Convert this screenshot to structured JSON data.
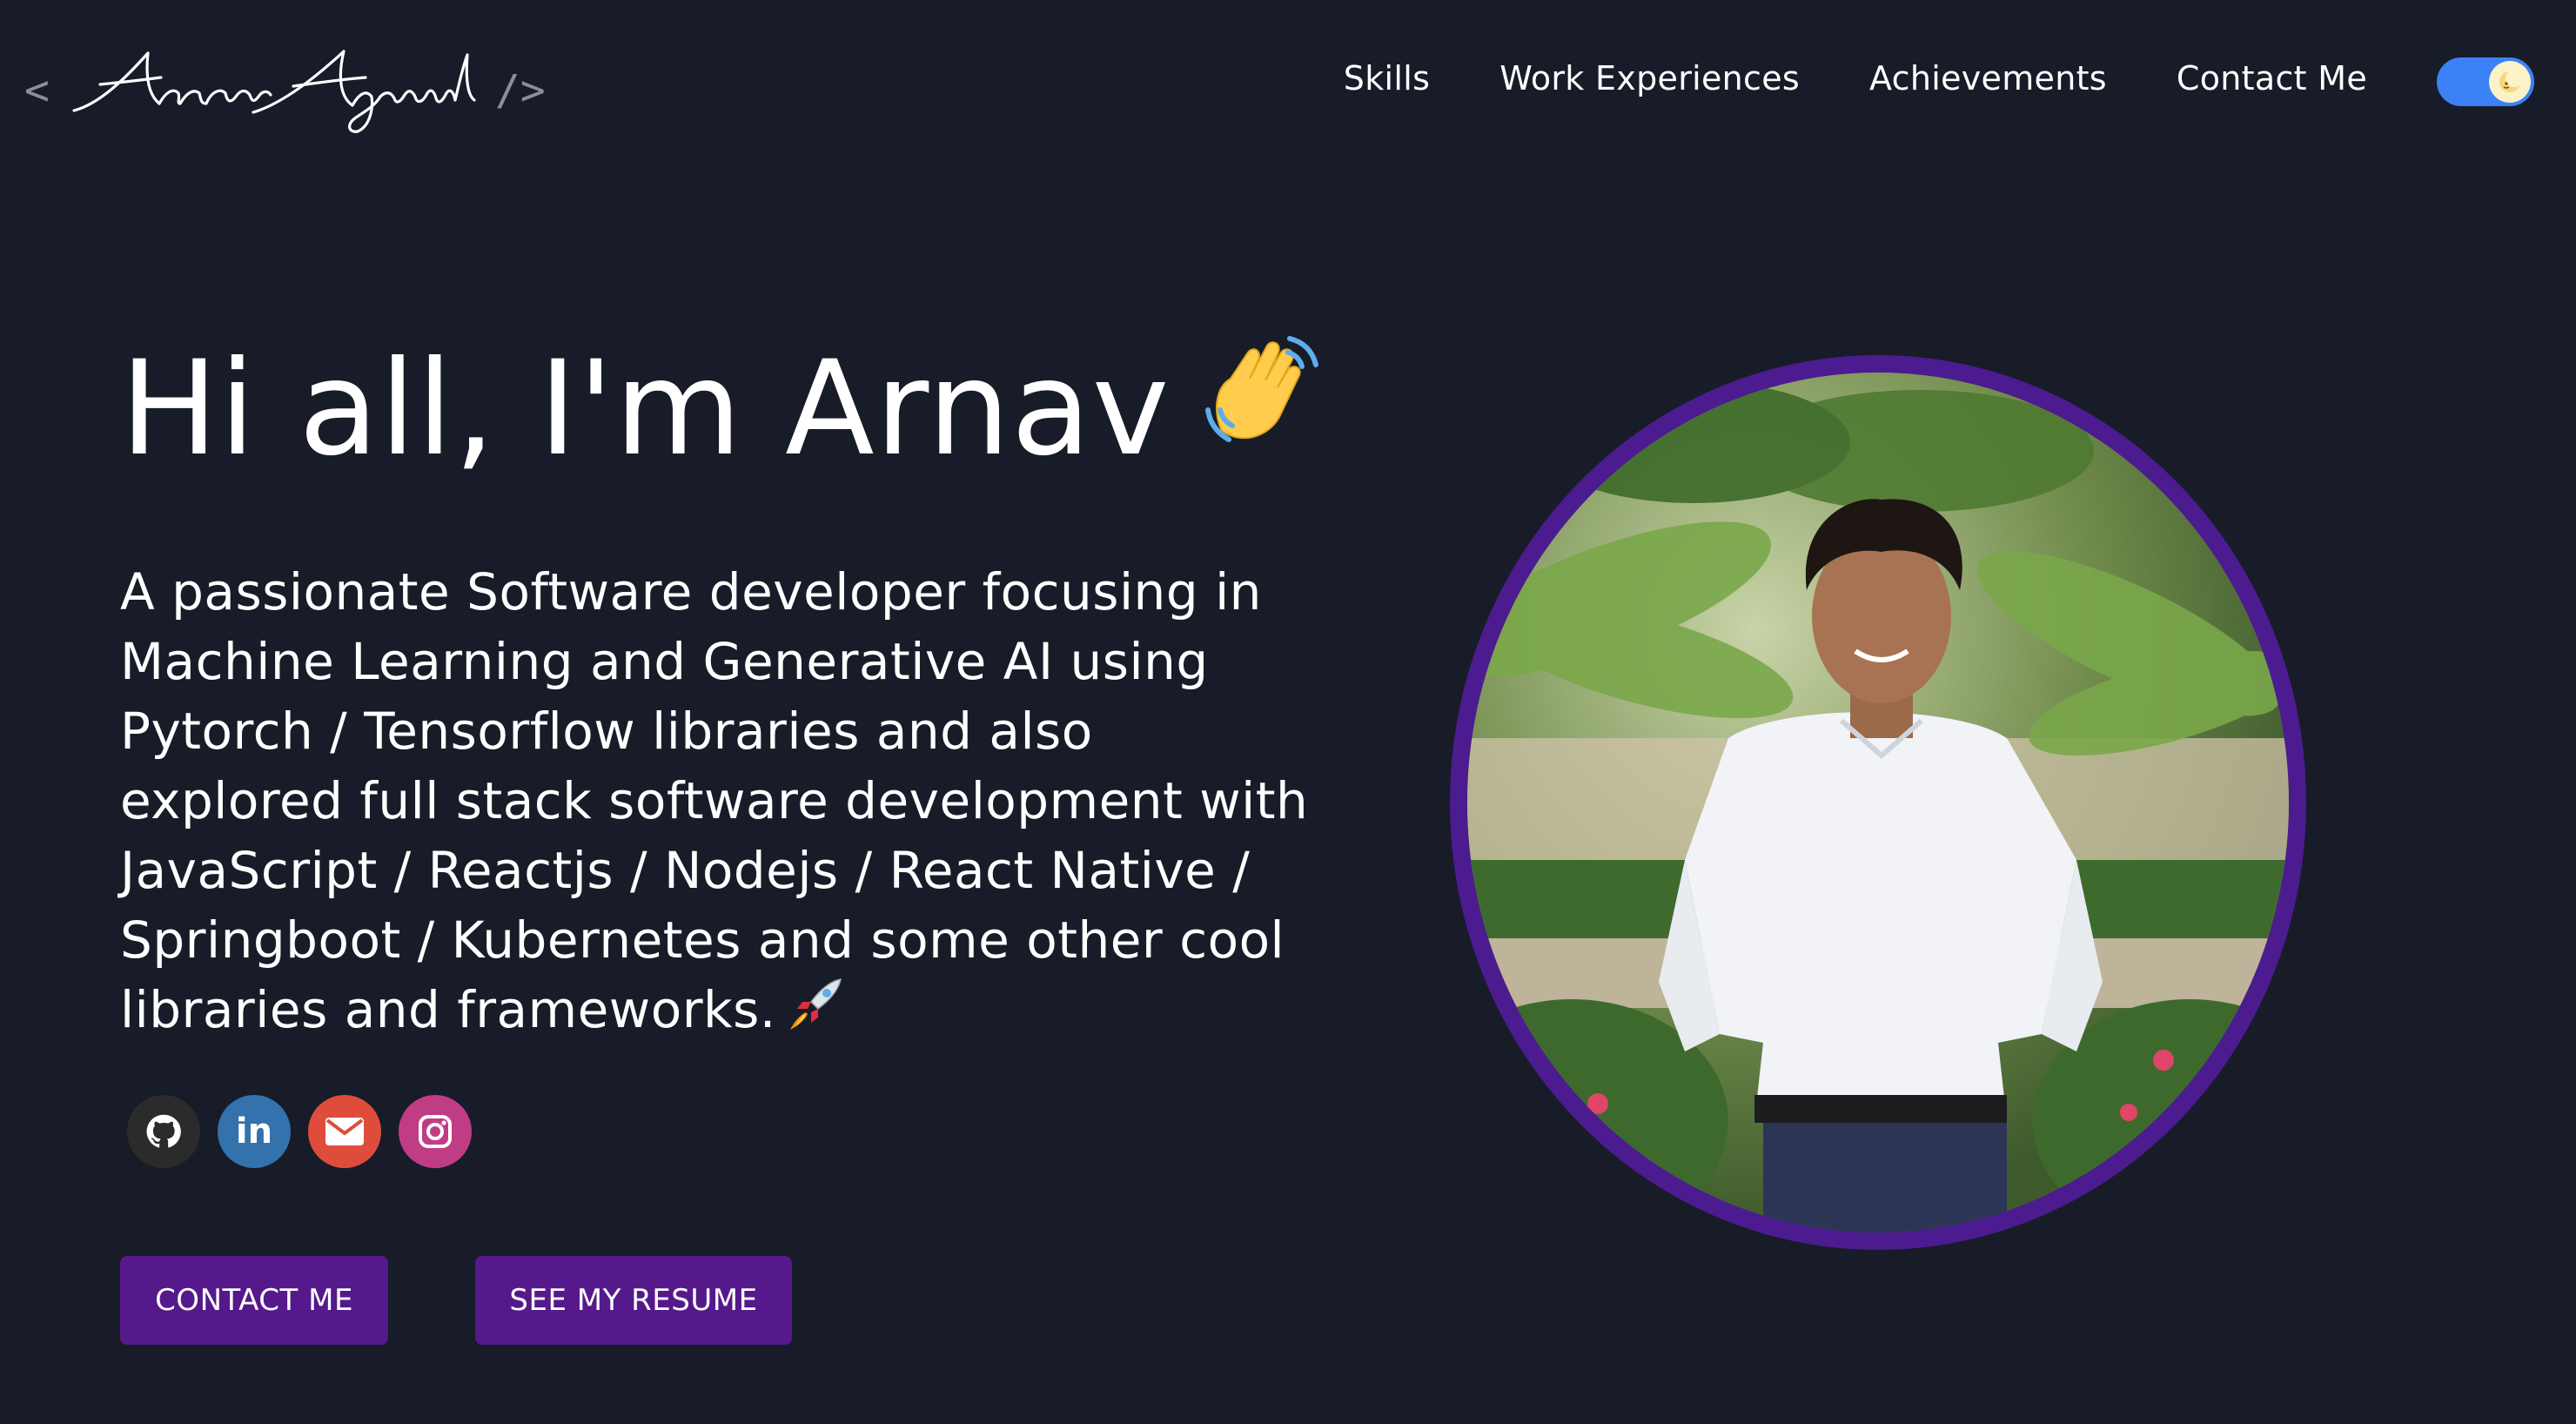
{
  "header": {
    "logo_open": "<",
    "logo_name": "Arnav Agarwal",
    "logo_close": "/>",
    "nav": [
      {
        "label": "Skills"
      },
      {
        "label": "Work Experiences"
      },
      {
        "label": "Achievements"
      },
      {
        "label": "Contact Me"
      }
    ],
    "theme_toggle": {
      "state": "dark",
      "icon": "moon-icon",
      "color": "#3b82f6"
    }
  },
  "hero": {
    "title": "Hi all, I'm Arnav",
    "title_emoji": "waving-hand-icon",
    "description": "A passionate Software developer focusing in Machine Learning and Generative AI using Pytorch / Tensorflow libraries and also explored full stack software development with JavaScript / Reactjs / Nodejs / React Native / Springboot / Kubernetes and some other cool libraries and frameworks.",
    "description_emoji": "rocket-icon",
    "socials": [
      {
        "name": "github-icon",
        "color": "#2b2b2b"
      },
      {
        "name": "linkedin-icon",
        "color": "#3372ad",
        "text": "in"
      },
      {
        "name": "email-icon",
        "color": "#df4c3b"
      },
      {
        "name": "instagram-icon",
        "color": "#c03d86"
      }
    ],
    "buttons": {
      "contact": "CONTACT ME",
      "resume": "SEE MY RESUME"
    },
    "portrait_alt": "portrait photo"
  },
  "colors": {
    "background": "#171c28",
    "accent": "#55198b",
    "portrait_border": "#4c1b8f"
  }
}
